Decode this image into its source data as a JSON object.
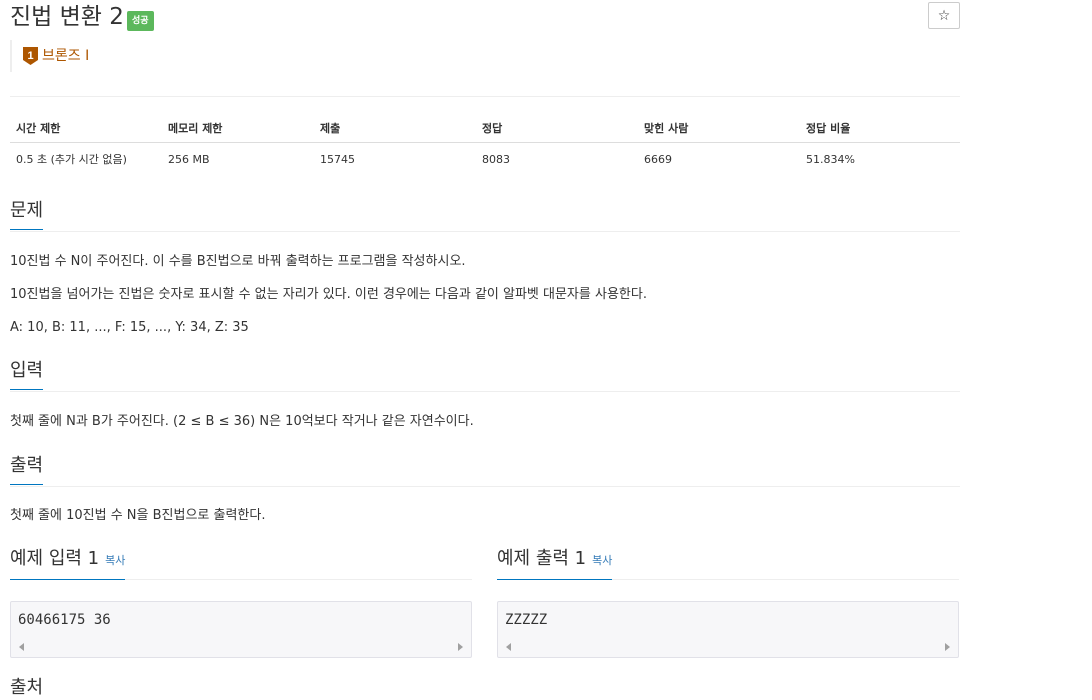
{
  "problem": {
    "title": "진법 변환 2",
    "result_badge": "성공",
    "star_icon": "☆",
    "tier_number": "1",
    "tier": "브론즈 I"
  },
  "info_table": {
    "headers": [
      "시간 제한",
      "메모리 제한",
      "제출",
      "정답",
      "맞힌 사람",
      "정답 비율"
    ],
    "values": [
      "0.5 초 (추가 시간 없음)",
      "256 MB",
      "15745",
      "8083",
      "6669",
      "51.834%"
    ]
  },
  "sections": {
    "problem": {
      "heading": "문제",
      "lines": [
        "10진법 수 N이 주어진다. 이 수를 B진법으로 바꿔 출력하는 프로그램을 작성하시오.",
        "10진법을 넘어가는 진법은 숫자로 표시할 수 없는 자리가 있다. 이런 경우에는 다음과 같이 알파벳 대문자를 사용한다.",
        "A: 10, B: 11, ..., F: 15, ..., Y: 34, Z: 35"
      ]
    },
    "input": {
      "heading": "입력",
      "text": "첫째 줄에 N과 B가 주어진다. (2 ≤ B ≤ 36) N은 10억보다 작거나 같은 자연수이다."
    },
    "output": {
      "heading": "출력",
      "text": "첫째 줄에 10진법 수 N을 B진법으로 출력한다."
    },
    "sample_input": {
      "heading": "예제 입력 1",
      "copy_label": "복사",
      "value": "60466175 36"
    },
    "sample_output": {
      "heading": "예제 출력 1",
      "copy_label": "복사",
      "value": "ZZZZZ"
    },
    "source_heading_partial": "출처"
  },
  "colors": {
    "success_badge": "#5cb85c",
    "bronze": "#ad5600",
    "link": "#337ab7",
    "heading_underline": "#0076c0"
  }
}
